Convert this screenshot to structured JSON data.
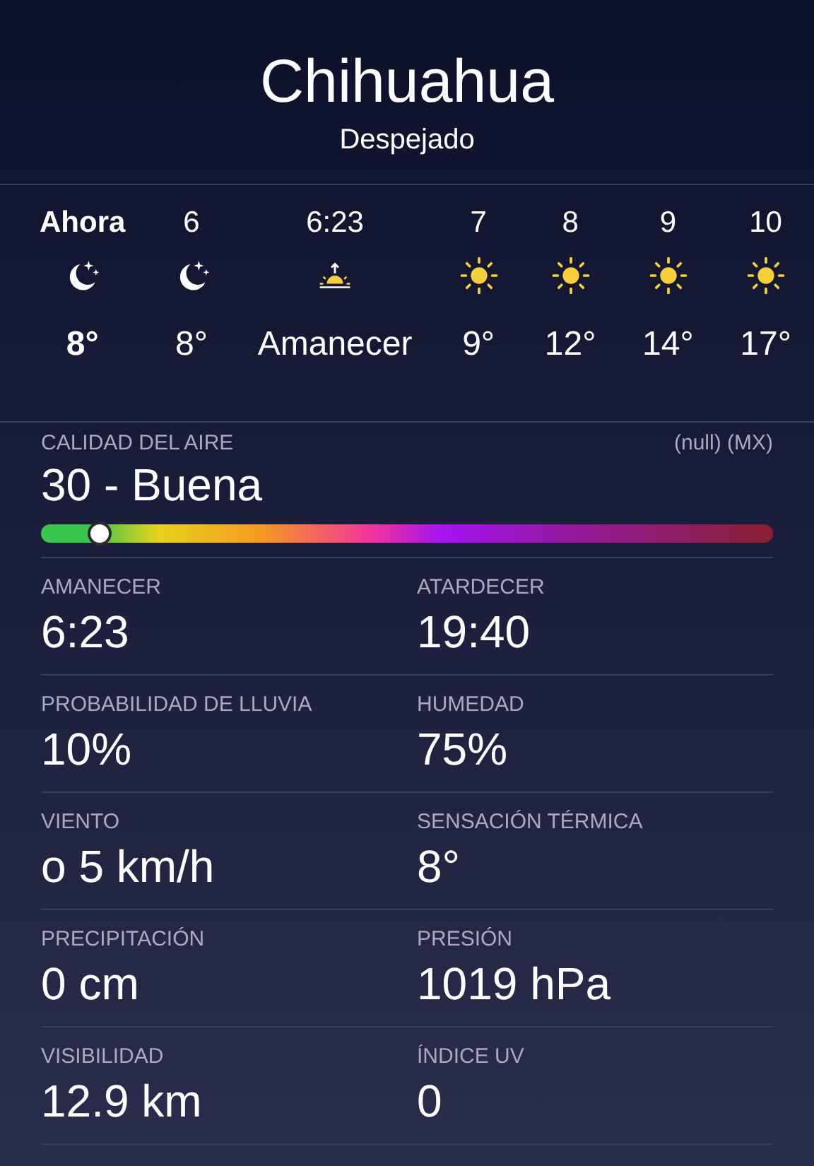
{
  "location": {
    "city": "Chihuahua",
    "condition": "Despejado"
  },
  "hourly": [
    {
      "time": "Ahora",
      "kind": "moon",
      "temp": "8°",
      "current": true
    },
    {
      "time": "6",
      "kind": "moon",
      "temp": "8°",
      "current": false
    },
    {
      "time": "6:23",
      "kind": "sunrise",
      "temp": "Amanecer",
      "current": false
    },
    {
      "time": "7",
      "kind": "sun",
      "temp": "9°",
      "current": false
    },
    {
      "time": "8",
      "kind": "sun",
      "temp": "12°",
      "current": false
    },
    {
      "time": "9",
      "kind": "sun",
      "temp": "14°",
      "current": false
    },
    {
      "time": "10",
      "kind": "sun",
      "temp": "17°",
      "current": false
    }
  ],
  "air_quality": {
    "label": "CALIDAD DEL AIRE",
    "source": "(null) (MX)",
    "value": "30 - Buena",
    "level": 0.08
  },
  "details": [
    [
      {
        "label": "AMANECER",
        "value": "6:23"
      },
      {
        "label": "ATARDECER",
        "value": "19:40"
      }
    ],
    [
      {
        "label": "PROBABILIDAD DE LLUVIA",
        "value": "10%"
      },
      {
        "label": "HUMEDAD",
        "value": "75%"
      }
    ],
    [
      {
        "label": "VIENTO",
        "value": "o 5 km/h"
      },
      {
        "label": "SENSACIÓN TÉRMICA",
        "value": "8°"
      }
    ],
    [
      {
        "label": "PRECIPITACIÓN",
        "value": "0 cm"
      },
      {
        "label": "PRESIÓN",
        "value": "1019 hPa"
      }
    ],
    [
      {
        "label": "VISIBILIDAD",
        "value": "12.9 km"
      },
      {
        "label": "ÍNDICE UV",
        "value": "0"
      }
    ]
  ]
}
